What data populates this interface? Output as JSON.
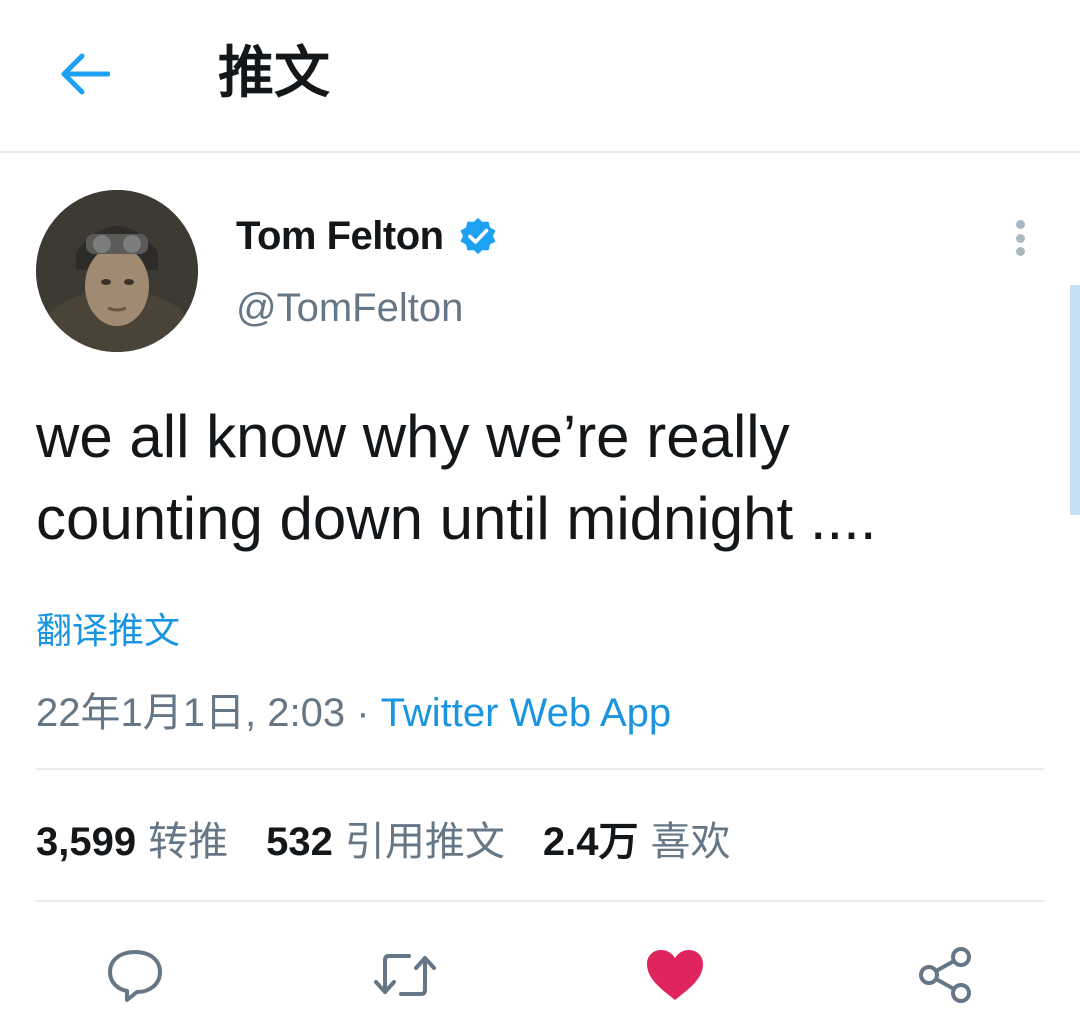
{
  "header": {
    "title": "推文",
    "back_icon": "arrow-left-icon",
    "accent_color": "#1da1f2"
  },
  "tweet": {
    "display_name": "Tom Felton",
    "verified_icon": "verified-badge-icon",
    "handle": "@TomFelton",
    "more_icon": "more-vertical-icon",
    "text_line1": "we all know why we’re really",
    "text_line2": "counting down until midnight ....",
    "translate_label": "翻译推文",
    "timestamp": "22年1月1日, 2:03",
    "separator": "·",
    "source": "Twitter Web App"
  },
  "stats": {
    "retweets_count": "3,599",
    "retweets_label": "转推",
    "quotes_count": "532",
    "quotes_label": "引用推文",
    "likes_count": "2.4万",
    "likes_label": "喜欢"
  },
  "actions": {
    "reply_icon": "reply-icon",
    "retweet_icon": "retweet-icon",
    "like_icon": "heart-icon",
    "share_icon": "share-icon",
    "like_color": "#e0245e"
  }
}
